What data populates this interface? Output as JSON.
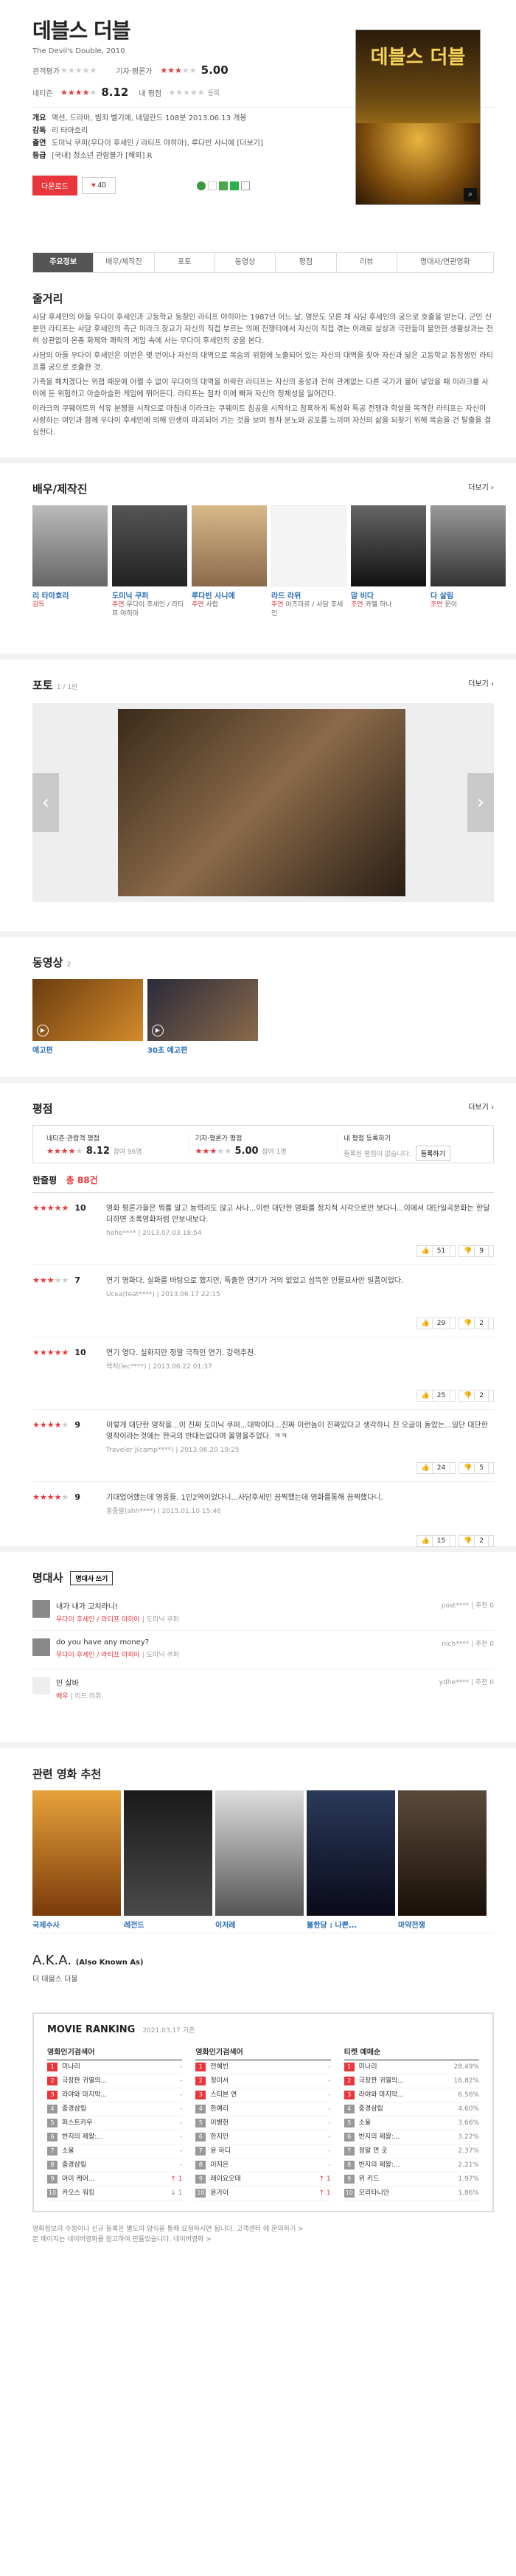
{
  "movie": {
    "title": "데블스 더블",
    "subtitle": "The Devil's Double, 2010",
    "poster_title": "데블스 더블",
    "rating_net_label": "관객평가",
    "rating_net_stars": "★★★★★",
    "rating_critic_label": "기자·평론가",
    "rating_critic_value": "5.00",
    "rating_critic_stars": "★★★",
    "rating_critic_off": "★★",
    "rating_user_label": "네티즌",
    "rating_user_value": "8.12",
    "rating_user_stars": "★★★★",
    "rating_user_off": "★",
    "my_rating_label": "내 평점",
    "my_rating_note": "등록",
    "meta": [
      {
        "k": "개요",
        "v": "액션, 드라마, 범죄  벨기에, 네덜란드  108분  2013.06.13 개봉"
      },
      {
        "k": "감독",
        "v": "리 타마호리"
      },
      {
        "k": "출연",
        "v": "도미닉 쿠퍼(우다이 후세인 / 라티프 야히아), 루다빈 사니에 [더보기]"
      },
      {
        "k": "등급",
        "v": "[국내] 청소년 관람불가 [해외] R"
      }
    ],
    "download_label": "다운로드",
    "like_label": "40",
    "like_heart": "♥"
  },
  "tabs": [
    "주요정보",
    "배우/제작진",
    "포토",
    "동영상",
    "평점",
    "리뷰",
    "명대사/연관영화"
  ],
  "plot": {
    "heading": "줄거리",
    "paragraphs": [
      "사담 후세인의 아들 우다이 후세인과 고등학교 동창인 라티프 야히아는 1987년 어느 날, 영문도 모른 채 사담 후세인의 궁으로 호출을 받는다. 군인 신분인 라티프는 사담 후세인의 측근 이라크 장교가 자신의 직접 부르는 의에 전쟁터에서 자신이 직접 겪는 이래로 살상과 극한들이 불안한 생활상과는 전혀 상관없이 온종 화제와 쾌락의 게임 속에 사는 우다이 후세인의 궁을 본다.",
      "사담의 아들 우다이 후세인은 이번은 몇 번이나 자신의 대역으로 목숨의 위협에 노출되어 있는 자신의 대역을 찾아 자신과 닮은 고등학교 동창생인 라티프를 궁으로 호출한 것.",
      "가족을 해치겠다는 위협 때문에 어쩔 수 없이 우다이의 대역을 허락한 라티프는 자신의 충성과 전혀 관계없는 다른 국가가 불어 넣었을 때 이라크를 사이에 둔 위험하고 아슬아슬한 게임에 뛰어든다. 라티프는 점차 이에 빠져 자신의 정체성을 잃어간다.",
      "이라크의 쿠웨이트의 석유 분쟁을 시작으로 마침내 이라크는 쿠웨이트 침공을 시작하고 참혹하게 특성화 특공 전쟁과 학살을 목격한 라티프는 자신이 사랑하는 여인과 함께 우다이 후세인에 의해 인생이 파괴되어 가는 것을 보며 점차 분노와 공포를 느끼며 자신의 삶을 되찾기 위해 목숨을 건 탈출을 결심한다."
    ]
  },
  "cast": {
    "heading": "배우/제작진",
    "more": "더보기",
    "people": [
      {
        "name": "리 타마호리",
        "role": "감독",
        "role2": ""
      },
      {
        "name": "도미닉 쿠퍼",
        "role": "주연",
        "role2": "우다이 후세인 / 라티프 야히아"
      },
      {
        "name": "루다빈 사니에",
        "role": "주연",
        "role2": "사랍"
      },
      {
        "name": "라드 라위",
        "role": "주연",
        "role2": "아즈미르 / 사담 후세인"
      },
      {
        "name": "맘 비다",
        "role": "조연",
        "role2": "카멜 하나"
      },
      {
        "name": "다 살림",
        "role": "조연",
        "role2": "문이"
      }
    ]
  },
  "photo": {
    "heading": "포토",
    "counter": "1 / 1만",
    "more": "더보기"
  },
  "video": {
    "heading": "동영상",
    "count": "2",
    "items": [
      {
        "title": "예고편"
      },
      {
        "title": "30초 예고편"
      }
    ]
  },
  "review": {
    "heading": "평점",
    "more": "더보기",
    "cells": [
      {
        "t": "네티즌·관람객 평점",
        "v": "8.12",
        "s": "참여 96명"
      },
      {
        "t": "기자·평론가 평점",
        "v": "5.00",
        "s": "참여 1명"
      },
      {
        "t": "내 평점 등록하기",
        "v": "",
        "s": "등록된 평점이 없습니다."
      }
    ],
    "register": "등록하기",
    "count_label": "한줄평",
    "count_value": "총 88건",
    "items": [
      {
        "stars": "★★★★★",
        "off": "",
        "score": "10",
        "text": "영화 평론가들은 뭐를 알고 능력리도 않고 사나...이런 대단한 영화를 정치적 시각으로만 보다니...이에서 대단일곡문화는 한달 더하면 조폭영화처럼 안보내보다.",
        "by": "hehe**** | 2013.07.03 18:54",
        "up": "51",
        "down": "9"
      },
      {
        "stars": "★★★",
        "off": "★★",
        "score": "7",
        "text": "연기 영화다. 실화를 바탕으로 했지만, 특출한 연기가 거의 없었고 섬뜩한 인물묘사만 일품이었다.",
        "by": "Ucea(teat****) | 2013.06.17 22:15",
        "up": "29",
        "down": "2"
      },
      {
        "stars": "★★★★★",
        "off": "",
        "score": "10",
        "text": "연기 영다. 실화지만 정말 극적인 연기. 강력추천.",
        "by": "렉처(lec****) | 2013.06.22 01:37",
        "up": "25",
        "down": "2"
      },
      {
        "stars": "★★★★",
        "off": "★",
        "score": "9",
        "text": "이렇게 대단한 영작을...이 진짜 도미닉 쿠퍼...대박이다...진짜 이런놈이 진짜있다고 생각하니 진 오글이 돋았는...일단 대단한 영작이라는것에는 한국의 반대는없다며 올영을주었다. ㅋㅋ",
        "by": "Traveler J(camp****) | 2013.06.20 19:25",
        "up": "24",
        "down": "5"
      },
      {
        "stars": "★★★★",
        "off": "★",
        "score": "9",
        "text": "기대었어했는데 영웅들. 1인2역이었다니...사담후세인 끔찍했는데 영화를통해 끔찍했다니.",
        "by": "홍중팔(ahh****) | 2015.01.10 15:46",
        "up": "15",
        "down": "2"
      }
    ]
  },
  "quotes": {
    "heading": "명대사",
    "btn": "명대사 쓰기",
    "items": [
      {
        "text": "내가 내가 고치라니!",
        "role": "우다이 후세인 / 라티프 야히아",
        "actor": "도미닉 쿠퍼",
        "user": "post****",
        "rec": "추천 0"
      },
      {
        "text": "do you have any money?",
        "role": "우다이 후세인 / 라티프 야히아",
        "actor": "도미닉 쿠퍼",
        "user": "nich****",
        "rec": "추천 0"
      },
      {
        "text": "인 살바",
        "role": "배우",
        "actor": "리드 라위",
        "user": "ydhe****",
        "rec": "추천 0"
      }
    ]
  },
  "related": {
    "heading": "관련 영화 추천",
    "items": [
      "국제수사",
      "레전드",
      "이저레",
      "불한당 : 나쁜...",
      "마약전쟁"
    ]
  },
  "aka": {
    "heading": "A.K.A.",
    "sub": "(Also Known As)",
    "value": "더 데블스 더블"
  },
  "ranking": {
    "heading": "MOVIE RANKING",
    "date": "2021.03.17 기준",
    "cols": [
      {
        "h": "영화인기검색어",
        "items": [
          {
            "t": "미나리",
            "v": "-",
            "up": false
          },
          {
            "t": "극장판 귀멸의...",
            "v": "-",
            "up": false
          },
          {
            "t": "라야와 마지막...",
            "v": "-",
            "up": false
          },
          {
            "t": "중경삼림",
            "v": "-",
            "up": false
          },
          {
            "t": "퍼스트카우",
            "v": "-",
            "up": false
          },
          {
            "t": "반지의 제왕:...",
            "v": "-",
            "up": false
          },
          {
            "t": "소울",
            "v": "-",
            "up": false
          },
          {
            "t": "중경삼림",
            "v": "-",
            "up": false
          },
          {
            "t": "아이 케어...",
            "v": "↑ 1",
            "up": true
          },
          {
            "t": "카오스 워킹",
            "v": "↓ 1",
            "up": false
          }
        ]
      },
      {
        "h": "영화인기검색어",
        "items": [
          {
            "t": "전혜빈",
            "v": "-",
            "up": false
          },
          {
            "t": "정이서",
            "v": "-",
            "up": false
          },
          {
            "t": "스티븐 연",
            "v": "-",
            "up": false
          },
          {
            "t": "한예리",
            "v": "-",
            "up": false
          },
          {
            "t": "이병헌",
            "v": "-",
            "up": false
          },
          {
            "t": "한지민",
            "v": "-",
            "up": false
          },
          {
            "t": "윤 하디",
            "v": "-",
            "up": false
          },
          {
            "t": "이지은",
            "v": "-",
            "up": false
          },
          {
            "t": "레이요오데",
            "v": "↑ 1",
            "up": true
          },
          {
            "t": "윤가이",
            "v": "↑ 1",
            "up": true
          }
        ]
      },
      {
        "h": "티켓 예매순",
        "items": [
          {
            "t": "미나리",
            "v": "28.49%",
            "up": false
          },
          {
            "t": "극장판 귀멸의...",
            "v": "16.82%",
            "up": false
          },
          {
            "t": "라야와 마지막...",
            "v": "6.56%",
            "up": false
          },
          {
            "t": "중경삼림",
            "v": "4.60%",
            "up": false
          },
          {
            "t": "소울",
            "v": "3.66%",
            "up": false
          },
          {
            "t": "반지의 제왕:...",
            "v": "3.22%",
            "up": false
          },
          {
            "t": "정말 먼 곳",
            "v": "2.37%",
            "up": false
          },
          {
            "t": "반지의 제왕:...",
            "v": "2.21%",
            "up": false
          },
          {
            "t": "위 키드",
            "v": "1.97%",
            "up": false
          },
          {
            "t": "모리타니안",
            "v": "1.86%",
            "up": false
          }
        ]
      }
    ]
  },
  "footer": {
    "l1": "영화정보의 수정이나 신규 등록은 별도의 양식을 통해 요청하시면 됩니다.  고객센터 에 문의하기 >",
    "l2": "본 페이지는 네이버영화를 참고하여 만들었습니다.  네이버영화 >"
  }
}
